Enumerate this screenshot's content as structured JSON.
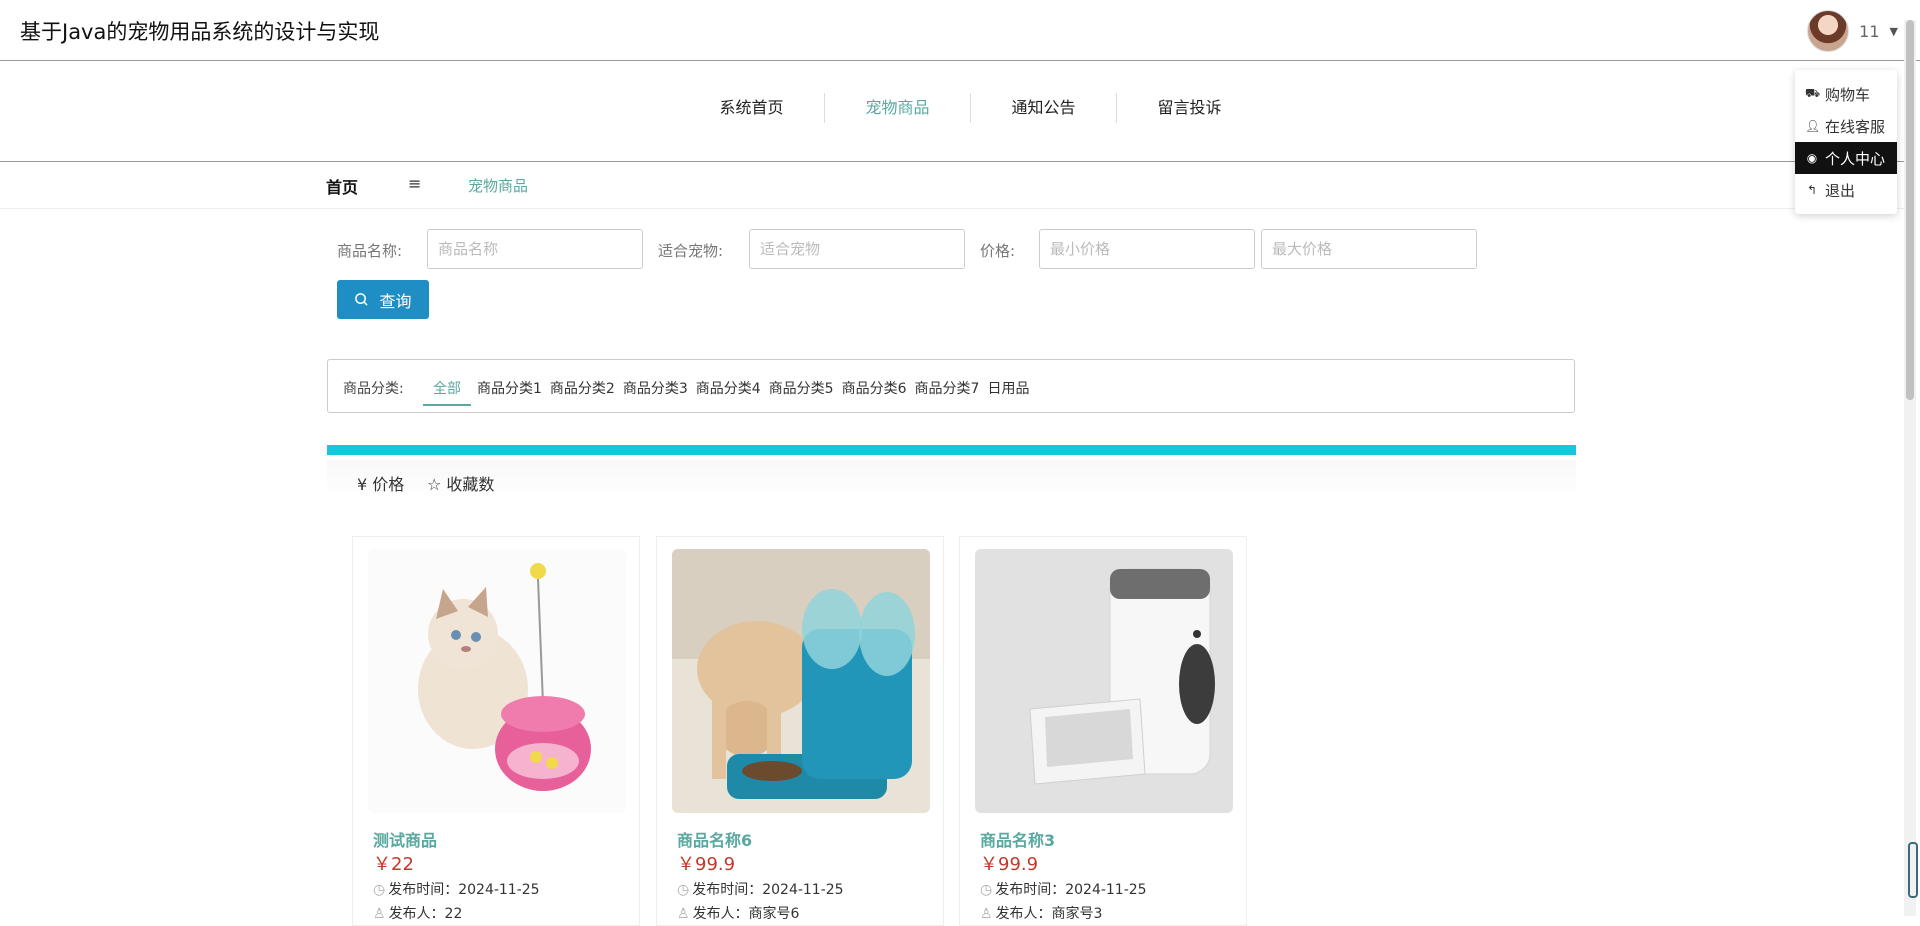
{
  "header": {
    "title": "基于Java的宠物用品系统的设计与实现",
    "username": "11"
  },
  "user_menu": {
    "items": [
      {
        "label": "购物车",
        "icon": "truck-icon"
      },
      {
        "label": "在线客服",
        "icon": "user-icon"
      },
      {
        "label": "个人中心",
        "icon": "user-circle-icon",
        "active": true
      },
      {
        "label": "退出",
        "icon": "reply-icon"
      }
    ]
  },
  "nav": {
    "items": [
      "系统首页",
      "宠物商品",
      "通知公告",
      "留言投诉"
    ],
    "active": "宠物商品"
  },
  "breadcrumb": {
    "home": "首页",
    "separator": "≡",
    "current": "宠物商品"
  },
  "search": {
    "name_label": "商品名称:",
    "name_placeholder": "商品名称",
    "pet_label": "适合宠物:",
    "pet_placeholder": "适合宠物",
    "price_label": "价格:",
    "min_placeholder": "最小价格",
    "max_placeholder": "最大价格",
    "button_label": "查询"
  },
  "categories": {
    "label": "商品分类:",
    "items": [
      "全部",
      "商品分类1",
      "商品分类2",
      "商品分类3",
      "商品分类4",
      "商品分类5",
      "商品分类6",
      "商品分类7",
      "日用品"
    ],
    "active": "全部"
  },
  "sort": {
    "price": "¥ 价格",
    "favorites": "☆ 收藏数"
  },
  "products": [
    {
      "name": "测试商品",
      "price": "￥22",
      "time": "发布时间：2024-11-25",
      "author": "发布人：22"
    },
    {
      "name": "商品名称6",
      "price": "￥99.9",
      "time": "发布时间：2024-11-25",
      "author": "发布人：商家号6"
    },
    {
      "name": "商品名称3",
      "price": "￥99.9",
      "time": "发布时间：2024-11-25",
      "author": "发布人：商家号3"
    }
  ],
  "colors": {
    "accent": "#59a9a0",
    "button": "#1f8ec4",
    "cyan_bar": "#16c8dc",
    "price": "#c0392b"
  }
}
